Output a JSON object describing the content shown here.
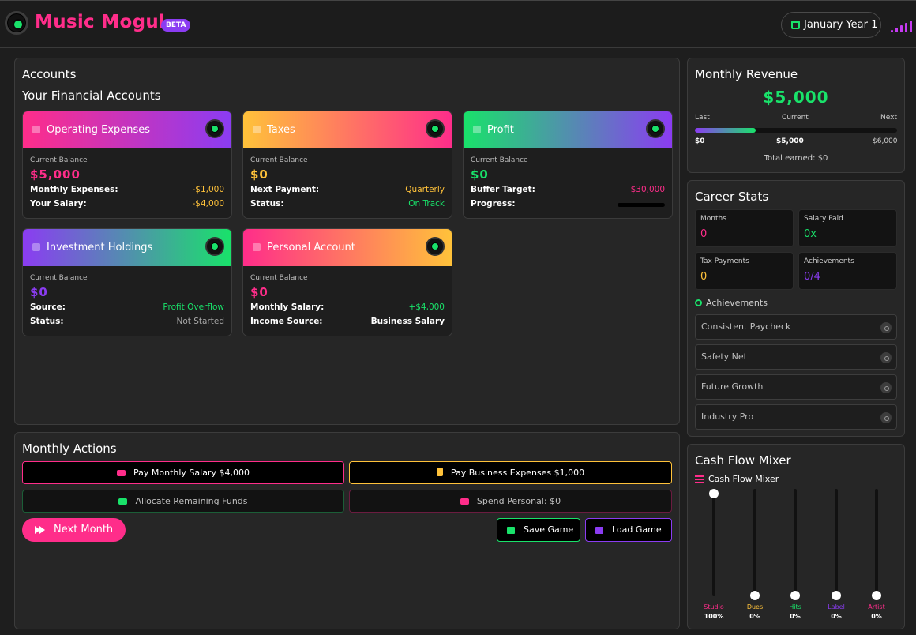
{
  "header": {
    "app_title": "Music Mogul",
    "badge": "BETA",
    "date": "January Year 1"
  },
  "accounts_panel": {
    "title": "Accounts",
    "subtitle": "Your Financial Accounts",
    "cards": [
      {
        "name": "Operating Expenses",
        "balance_label": "Current Balance",
        "balance": "$5,000",
        "rows": [
          {
            "label": "Monthly Expenses:",
            "value": "-$1,000"
          },
          {
            "label": "Your Salary:",
            "value": "-$4,000"
          }
        ]
      },
      {
        "name": "Taxes",
        "balance_label": "Current Balance",
        "balance": "$0",
        "rows": [
          {
            "label": "Next Payment:",
            "value": "Quarterly"
          },
          {
            "label": "Status:",
            "value": "On Track"
          }
        ]
      },
      {
        "name": "Profit",
        "balance_label": "Current Balance",
        "balance": "$0",
        "rows": [
          {
            "label": "Buffer Target:",
            "value": "$30,000"
          },
          {
            "label": "Progress:",
            "value": ""
          }
        ],
        "progress": 0
      },
      {
        "name": "Investment Holdings",
        "balance_label": "Current Balance",
        "balance": "$0",
        "rows": [
          {
            "label": "Source:",
            "value": "Profit Overflow"
          },
          {
            "label": "Status:",
            "value": "Not Started"
          }
        ]
      },
      {
        "name": "Personal Account",
        "balance_label": "Current Balance",
        "balance": "$0",
        "rows": [
          {
            "label": "Monthly Salary:",
            "value": "+$4,000"
          },
          {
            "label": "Income Source:",
            "value": "Business Salary"
          }
        ]
      }
    ]
  },
  "actions_panel": {
    "title": "Monthly Actions",
    "pay_salary": "Pay Monthly Salary $4,000",
    "pay_expenses": "Pay Business Expenses $1,000",
    "allocate": "Allocate Remaining Funds",
    "spend": "Spend Personal: $0",
    "next_month": "Next Month",
    "save": "Save Game",
    "load": "Load Game"
  },
  "revenue_panel": {
    "title": "Monthly Revenue",
    "amount": "$5,000",
    "label_last": "Last",
    "label_current": "Current",
    "label_next": "Next",
    "val_last": "$0",
    "val_current": "$5,000",
    "val_next": "$6,000",
    "total": "Total earned: $0",
    "progress_fraction": 0.3
  },
  "stats_panel": {
    "title": "Career Stats",
    "stats": [
      {
        "label": "Months",
        "value": "0"
      },
      {
        "label": "Salary Paid",
        "value": "0x"
      },
      {
        "label": "Tax Payments",
        "value": "0"
      },
      {
        "label": "Achievements",
        "value": "0/4"
      }
    ],
    "achievements_heading": "Achievements",
    "achievements": [
      "Consistent Paycheck",
      "Safety Net",
      "Future Growth",
      "Industry Pro"
    ]
  },
  "mixer_panel": {
    "title": "Cash Flow Mixer",
    "subtitle": "Cash Flow Mixer",
    "channels": [
      {
        "name": "Studio",
        "pct": "100%",
        "level": 1.0
      },
      {
        "name": "Dues",
        "pct": "0%",
        "level": 0
      },
      {
        "name": "Hits",
        "pct": "0%",
        "level": 0
      },
      {
        "name": "Label",
        "pct": "0%",
        "level": 0
      },
      {
        "name": "Artist",
        "pct": "0%",
        "level": 0
      }
    ]
  },
  "colors": {
    "pink": "#ff2d8a",
    "purple": "#8b3cf2",
    "green": "#19e26a",
    "yellow": "#ffc23a"
  }
}
